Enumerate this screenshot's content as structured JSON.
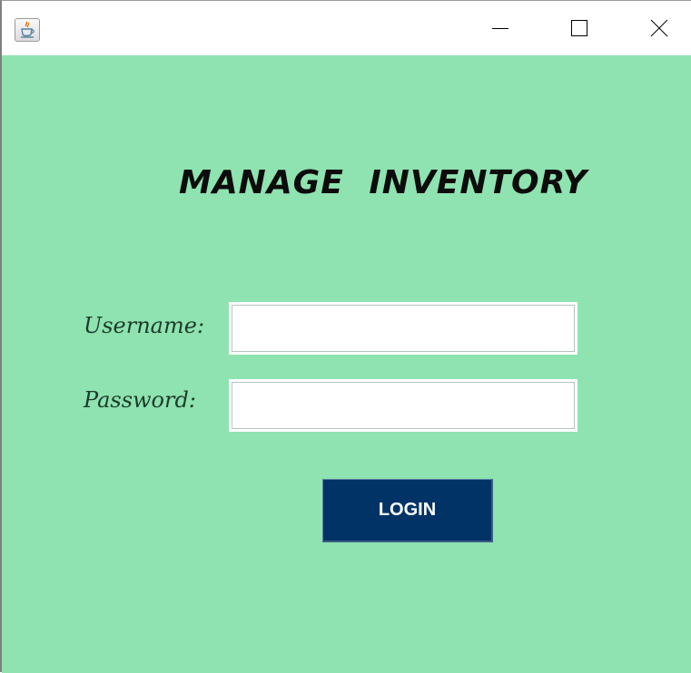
{
  "window": {
    "app_icon": "java-coffee-cup-icon",
    "controls": {
      "minimize": "minimize-icon",
      "maximize": "maximize-icon",
      "close": "close-icon"
    }
  },
  "form": {
    "title": "MANAGE   INVENTORY",
    "username_label": "Username:",
    "username_value": "",
    "password_label": "Password:",
    "password_value": "",
    "login_label": "LOGIN"
  },
  "colors": {
    "background": "#8ee3b0",
    "button": "#013366",
    "button_text": "#ffffff",
    "title_text": "#0c0c0c"
  }
}
